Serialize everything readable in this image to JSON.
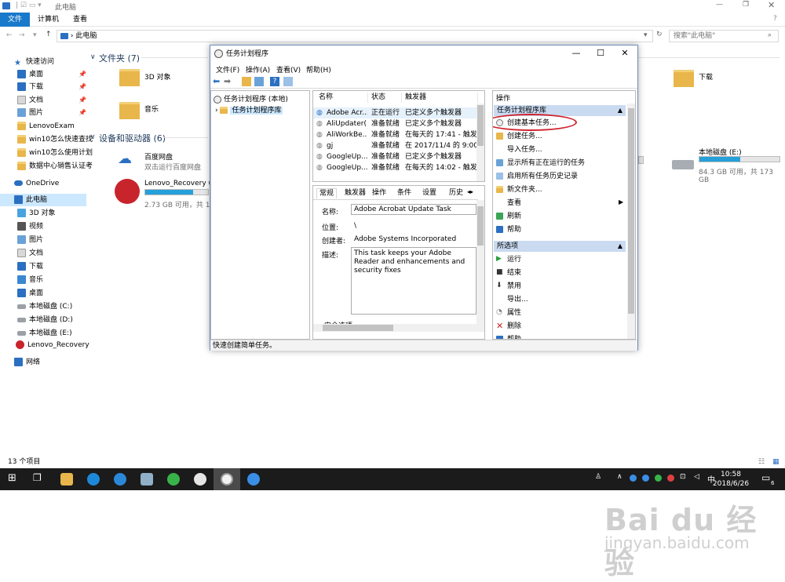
{
  "explorer": {
    "title": "此电脑",
    "ribbon_tabs": [
      "文件",
      "计算机",
      "查看"
    ],
    "address": "此电脑",
    "search_placeholder": "搜索\"此电脑\"",
    "nav": {
      "quick_access": "快速访问",
      "pinned": [
        "桌面",
        "下载",
        "文档",
        "图片"
      ],
      "recent": [
        "LenovoExam",
        "win10怎么快速查找",
        "win10怎么使用计划",
        "数据中心销售认证考"
      ],
      "onedrive": "OneDrive",
      "this_pc": "此电脑",
      "pc_items": [
        "3D 对象",
        "视频",
        "图片",
        "文档",
        "下载",
        "音乐",
        "桌面",
        "本地磁盘 (C:)",
        "本地磁盘 (D:)",
        "本地磁盘 (E:)",
        "Lenovo_Recovery"
      ],
      "network": "网络"
    },
    "folders_header": "文件夹 (7)",
    "folders": [
      "3D 对象",
      "音乐",
      "下载"
    ],
    "devices_header": "设备和驱动器 (6)",
    "baidu": {
      "name": "百度网盘",
      "sub": "双击运行百度网盘"
    },
    "recovery": {
      "name": "Lenovo_Recovery (F:)",
      "free": "2.73 GB 可用，共 11.",
      "fill": 0.76
    },
    "drive_e": {
      "name": "本地磁盘 (E:)",
      "free": "84.3 GB 可用，共 173 GB",
      "fill": 0.51
    },
    "status": "13 个项目"
  },
  "dialog": {
    "title": "任务计划程序",
    "menus": [
      "文件(F)",
      "操作(A)",
      "查看(V)",
      "帮助(H)"
    ],
    "tree": [
      "任务计划程序 (本地)",
      "任务计划程序库"
    ],
    "list_headers": [
      "名称",
      "状态",
      "触发器"
    ],
    "tasks": [
      {
        "name": "Adobe Acr...",
        "status": "正在运行",
        "trigger": "已定义多个触发器"
      },
      {
        "name": "AliUpdater(...",
        "status": "准备就绪",
        "trigger": "已定义多个触发器"
      },
      {
        "name": "AliWorkBe...",
        "status": "准备就绪",
        "trigger": "在每天的 17:41 - 触发后"
      },
      {
        "name": "gj",
        "status": "准备就绪",
        "trigger": "在 2017/11/4 的 9:00 时"
      },
      {
        "name": "GoogleUp...",
        "status": "准备就绪",
        "trigger": "已定义多个触发器"
      },
      {
        "name": "GoogleUp...",
        "status": "准备就绪",
        "trigger": "在每天的 14:02 - 触发"
      }
    ],
    "detail_tabs": [
      "常规",
      "触发器",
      "操作",
      "条件",
      "设置",
      "历史"
    ],
    "detail": {
      "name_label": "名称:",
      "name_value": "Adobe Acrobat Update Task",
      "location_label": "位置:",
      "location_value": "\\",
      "author_label": "创建者:",
      "author_value": "Adobe Systems Incorporated",
      "desc_label": "描述:",
      "desc_value": "This task keeps your Adobe Reader and enhancements and security fixes",
      "security_label": "安全选项"
    },
    "actions_header": "操作",
    "lib_header": "任务计划程序库",
    "lib_actions": [
      "创建基本任务...",
      "创建任务...",
      "导入任务...",
      "显示所有正在运行的任务",
      "启用所有任务历史记录",
      "新文件夹...",
      "查看",
      "刷新",
      "帮助"
    ],
    "sel_header": "所选项",
    "sel_actions": [
      "运行",
      "结束",
      "禁用",
      "导出...",
      "属性",
      "删除",
      "帮助"
    ],
    "status": "快速创建简单任务。"
  },
  "taskbar": {
    "time": "10:58",
    "date": "2018/6/26",
    "ime": "中",
    "notify": "6"
  },
  "watermark": {
    "logo": "Bai du 经验",
    "url": "jingyan.baidu.com"
  },
  "colors": {
    "accent": "#1979ca",
    "highlight_circle": "#d0202a",
    "taskbar": "#1b1b1b"
  }
}
